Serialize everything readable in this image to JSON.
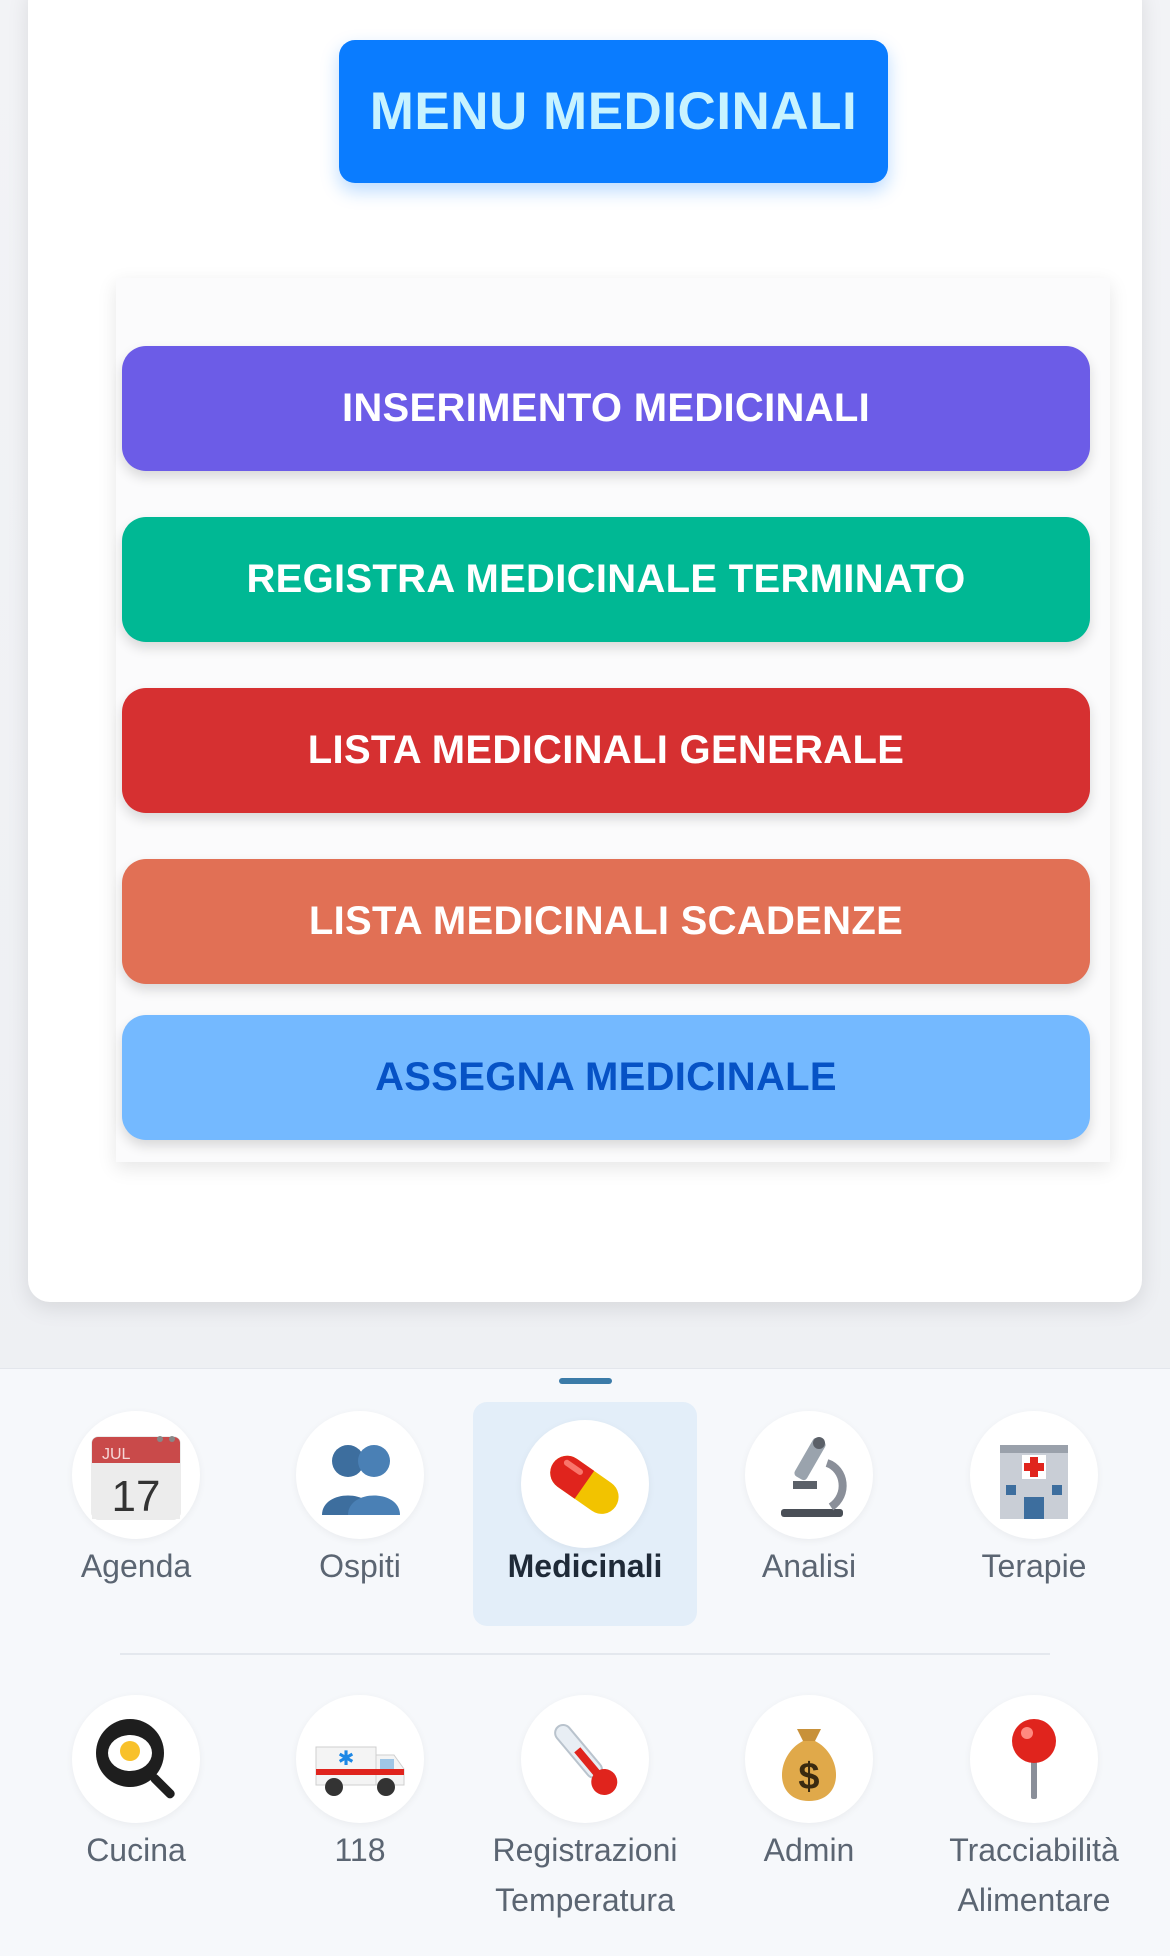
{
  "header": {
    "title_label": "MENU MEDICINALI"
  },
  "menu": {
    "items": [
      {
        "label": "INSERIMENTO MEDICINALI",
        "color": "#6c5ce7"
      },
      {
        "label": "REGISTRA MEDICINALE TERMINATO",
        "color": "#00b894"
      },
      {
        "label": "LISTA MEDICINALI GENERALE",
        "color": "#d63031"
      },
      {
        "label": "LISTA MEDICINALI SCADENZE",
        "color": "#e17055"
      },
      {
        "label": "ASSEGNA MEDICINALE",
        "color": "#74b9ff"
      }
    ]
  },
  "bottom_nav": {
    "active": "Medicinali",
    "calendar_month": "JUL",
    "calendar_day": "17",
    "items": [
      {
        "label": "Agenda",
        "icon": "calendar-icon"
      },
      {
        "label": "Ospiti",
        "icon": "people-icon"
      },
      {
        "label": "Medicinali",
        "icon": "pill-icon"
      },
      {
        "label": "Analisi",
        "icon": "microscope-icon"
      },
      {
        "label": "Terapie",
        "icon": "hospital-icon"
      },
      {
        "label": "Cucina",
        "icon": "frying-pan-icon"
      },
      {
        "label": "118",
        "icon": "ambulance-icon"
      },
      {
        "label_line1": "Registrazioni",
        "label_line2": "Temperatura",
        "icon": "thermometer-icon"
      },
      {
        "label": "Admin",
        "icon": "money-bag-icon"
      },
      {
        "label_line1": "Tracciabilità",
        "label_line2": "Alimentare",
        "icon": "pushpin-icon"
      }
    ]
  }
}
